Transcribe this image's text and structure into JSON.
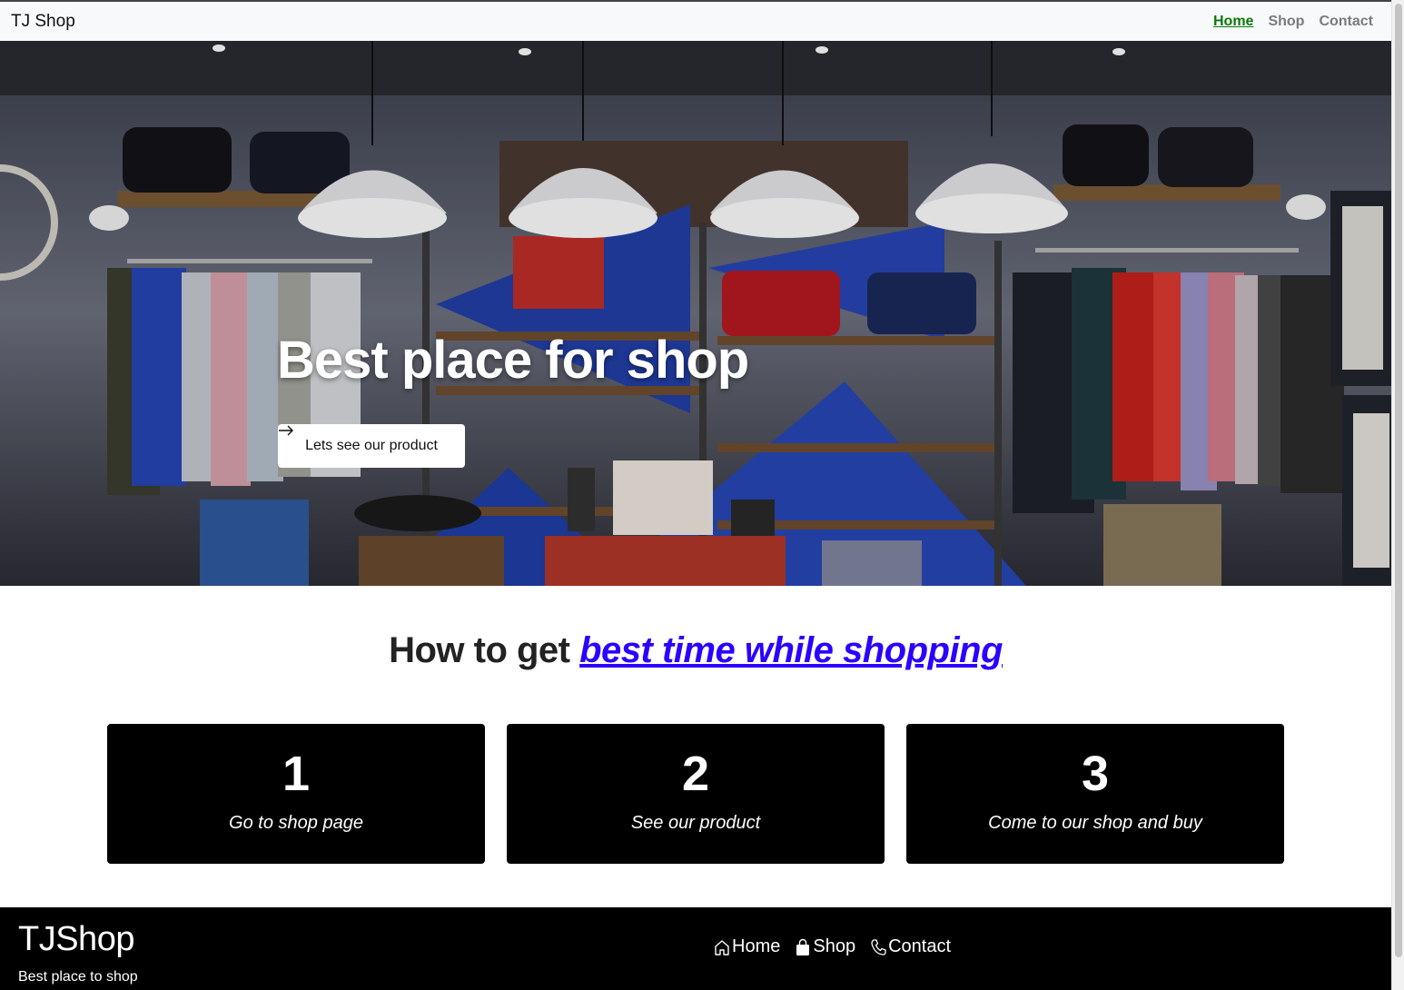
{
  "navbar": {
    "brand": "TJ Shop",
    "links": [
      {
        "label": "Home",
        "active": true
      },
      {
        "label": "Shop",
        "active": false
      },
      {
        "label": "Contact",
        "active": false
      }
    ]
  },
  "hero": {
    "title": "Best place for shop",
    "button_label": "Lets see our product",
    "button_icon": "arrow-right-icon"
  },
  "section": {
    "heading_prefix": "How to get ",
    "heading_link": "best time while shopping"
  },
  "cards": [
    {
      "number": "1",
      "text": "Go to shop page"
    },
    {
      "number": "2",
      "text": "See our product"
    },
    {
      "number": "3",
      "text": "Come to our shop and buy"
    }
  ],
  "footer": {
    "brand": "TJShop",
    "tagline": "Best place to shop",
    "links": [
      {
        "label": "Home",
        "icon": "house-icon"
      },
      {
        "label": "Shop",
        "icon": "shopping-bag-icon"
      },
      {
        "label": "Contact",
        "icon": "phone-icon"
      }
    ]
  },
  "colors": {
    "active_nav": "#0a7a0a",
    "heading_link": "#2b00ff",
    "card_bg": "#000000",
    "footer_bg": "#000000"
  }
}
